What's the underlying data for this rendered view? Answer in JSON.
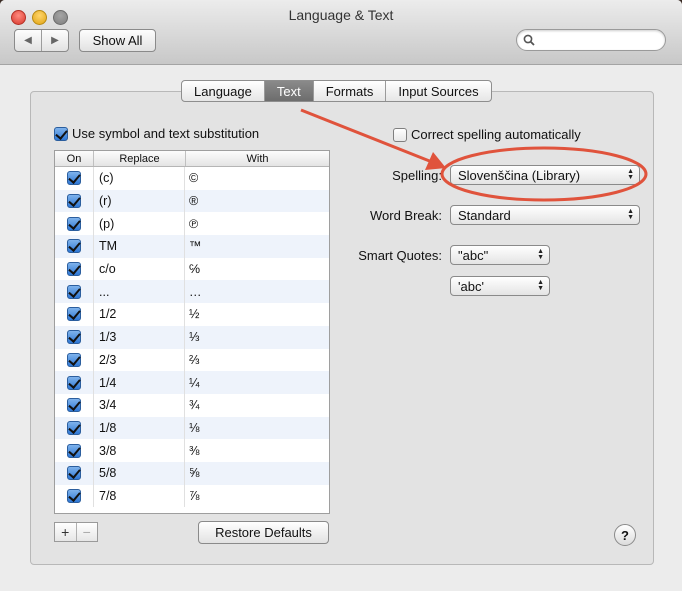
{
  "window": {
    "title": "Language & Text"
  },
  "toolbar": {
    "back_glyph": "◀",
    "forward_glyph": "▶",
    "show_all_label": "Show All",
    "search_placeholder": ""
  },
  "tabs": [
    {
      "label": "Language",
      "active": false
    },
    {
      "label": "Text",
      "active": true
    },
    {
      "label": "Formats",
      "active": false
    },
    {
      "label": "Input Sources",
      "active": false
    }
  ],
  "substitution": {
    "enabled_label": "Use symbol and text substitution",
    "enabled": true,
    "columns": [
      "On",
      "Replace",
      "With"
    ],
    "rows": [
      {
        "on": true,
        "replace": "(c)",
        "with": "©"
      },
      {
        "on": true,
        "replace": "(r)",
        "with": "®"
      },
      {
        "on": true,
        "replace": "(p)",
        "with": "℗"
      },
      {
        "on": true,
        "replace": "TM",
        "with": "™"
      },
      {
        "on": true,
        "replace": "c/o",
        "with": "℅"
      },
      {
        "on": true,
        "replace": "...",
        "with": "…"
      },
      {
        "on": true,
        "replace": "1/2",
        "with": "½"
      },
      {
        "on": true,
        "replace": "1/3",
        "with": "⅓"
      },
      {
        "on": true,
        "replace": "2/3",
        "with": "⅔"
      },
      {
        "on": true,
        "replace": "1/4",
        "with": "¼"
      },
      {
        "on": true,
        "replace": "3/4",
        "with": "¾"
      },
      {
        "on": true,
        "replace": "1/8",
        "with": "⅛"
      },
      {
        "on": true,
        "replace": "3/8",
        "with": "⅜"
      },
      {
        "on": true,
        "replace": "5/8",
        "with": "⅝"
      },
      {
        "on": true,
        "replace": "7/8",
        "with": "⅞"
      }
    ],
    "add_label": "+",
    "remove_label": "−",
    "restore_label": "Restore Defaults"
  },
  "spelling": {
    "correct_label": "Correct spelling automatically",
    "correct_enabled": false,
    "spelling_label": "Spelling:",
    "spelling_value": "Slovenščina (Library)",
    "word_break_label": "Word Break:",
    "word_break_value": "Standard",
    "smart_quotes_label": "Smart Quotes:",
    "double_quotes_value": "\"abc\"",
    "single_quotes_value": "'abc'"
  },
  "help_label": "?",
  "colors": {
    "annotation": "#e0533c",
    "checkbox_blue": "#2f78d5",
    "active_tab": "#7a7a7a"
  }
}
